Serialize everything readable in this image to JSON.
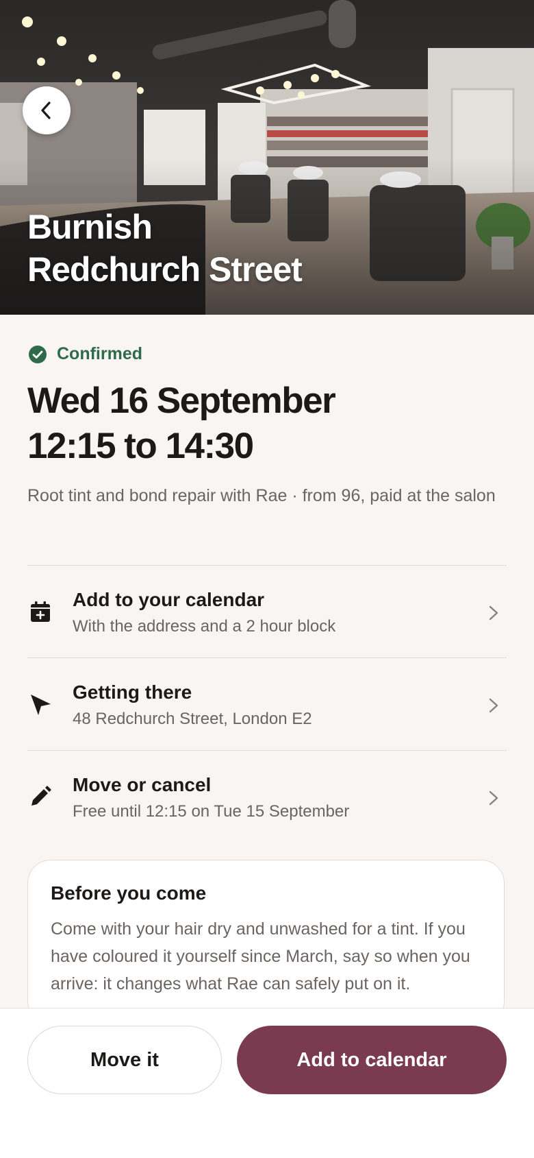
{
  "hero": {
    "title_line1": "Burnish",
    "title_line2": "Redchurch Street",
    "back_icon": "chevron-left-icon"
  },
  "status": {
    "label": "Confirmed",
    "icon": "check-circle-icon",
    "color": "#2f6b4a"
  },
  "appointment": {
    "date": "Wed 16 September",
    "time": "12:15 to 14:30",
    "summary": "Root tint and bond repair with Rae  ·  from 96, paid at the salon"
  },
  "actions": [
    {
      "label": "Add to your calendar",
      "sub": "With the address and a 2 hour block",
      "icon": "calendar-add-icon"
    },
    {
      "label": "Getting there",
      "sub": "48 Redchurch Street, London E2",
      "icon": "navigation-arrow-icon"
    },
    {
      "label": "Move or cancel",
      "sub": "Free until 12:15 on Tue 15 September",
      "icon": "pencil-icon"
    }
  ],
  "note": {
    "title": "Before you come",
    "body": "Come with your hair dry and unwashed for a tint. If you have coloured it yourself since March, say so when you arrive: it changes what Rae can safely put on it."
  },
  "footer": {
    "secondary_label": "Move it",
    "primary_label": "Add to calendar",
    "primary_color": "#7a3a50"
  }
}
